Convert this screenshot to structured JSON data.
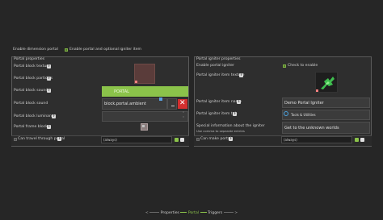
{
  "top": {
    "enable_dimension_label": "Enable dimension portal",
    "enable_portal_igniter_label": "Enable portal and optional igniter item"
  },
  "left_panel": {
    "title": "Portal properties",
    "rows": {
      "block_texture": "Portal block texture",
      "block_particles": "Portal block particles",
      "block_sound": "Portal block sound",
      "block_luminance": "Portal block luminance",
      "frame_block": "Portal frame block"
    },
    "particles_value": "PORTAL",
    "sound_value": "block.portal.ambient",
    "luminance_value": "",
    "can_travel_label": "Can travel through portal",
    "condition_value": "(always)"
  },
  "right_panel": {
    "title": "Portal igniter properties",
    "rows": {
      "enable_igniter": "Enable portal igniter",
      "igniter_texture": "Portal igniter item texture",
      "igniter_name": "Portal igniter item name",
      "igniter_tab": "Portal igniter item tab",
      "special_info": "Special information about the igniter"
    },
    "check_to_enable": "Check to enable",
    "item_name_value": "Demo Portal Igniter",
    "tab_value": "Tools & Utilities",
    "special_info_value": "Get to the unknown worlds",
    "special_info_note": "Use comma to separate entries",
    "can_make_label": "Can make portal",
    "condition_value": "(always)"
  },
  "footer": {
    "arrow_left": "<",
    "properties_tab": "Properties",
    "portal_tab": "Portal",
    "triggers_tab": "Triggers",
    "arrow_right": ">"
  },
  "colors": {
    "green": "#8bc34a",
    "red": "#d32f2f",
    "background": "#262626",
    "panel": "#2e2e2e"
  }
}
